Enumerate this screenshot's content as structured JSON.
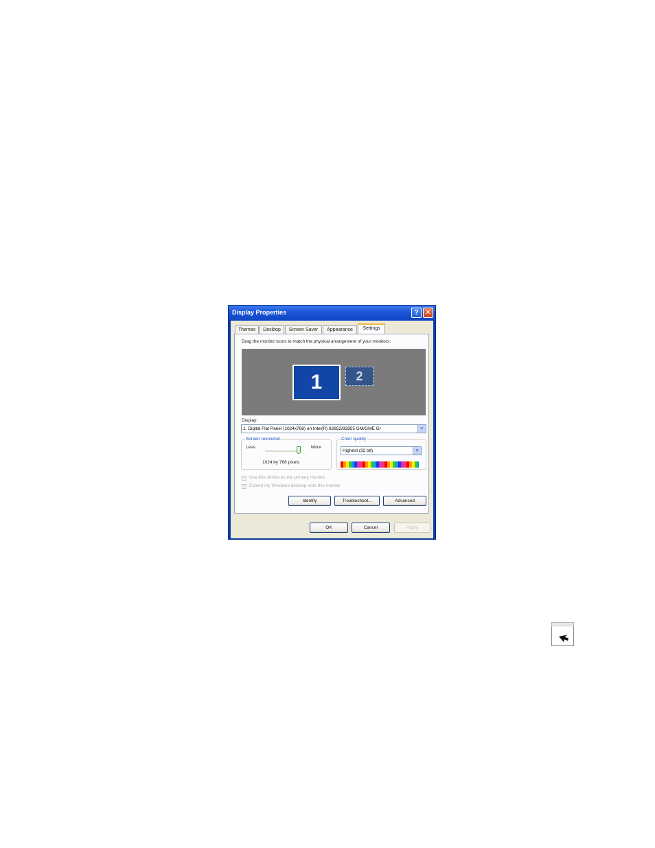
{
  "window": {
    "title": "Display Properties",
    "help_label": "?",
    "close_label": "✕"
  },
  "tabs": [
    {
      "label": "Themes",
      "active": false
    },
    {
      "label": "Desktop",
      "active": false
    },
    {
      "label": "Screen Saver",
      "active": false
    },
    {
      "label": "Appearance",
      "active": false
    },
    {
      "label": "Settings",
      "active": true
    }
  ],
  "settings": {
    "instruction": "Drag the monitor icons to match the physical arrangement of your monitors.",
    "monitors": [
      {
        "label": "1",
        "primary": true
      },
      {
        "label": "2",
        "primary": false
      }
    ],
    "display_label": "Display:",
    "display_value": "1. Digital Flat Panel (1024x768) on Intel(R) 82852/82855 GM/GME Gr",
    "resolution": {
      "group_label": "Screen resolution",
      "less_label": "Less",
      "more_label": "More",
      "value_text": "1024 by 768 pixels"
    },
    "color_quality": {
      "group_label": "Color quality",
      "selected": "Highest (32 bit)"
    },
    "primary_checkbox_label": "Use this device as the primary monitor",
    "extend_checkbox_label": "Extend my Windows desktop onto this monitor",
    "buttons": {
      "identify": "Identify",
      "troubleshoot": "Troubleshoot...",
      "advanced": "Advanced"
    }
  },
  "footer": {
    "ok": "OK",
    "cancel": "Cancel",
    "apply": "Apply"
  },
  "icons": {
    "dropdown_arrow": "▾",
    "check": "✓",
    "cursor": "arrow-cursor-icon"
  }
}
